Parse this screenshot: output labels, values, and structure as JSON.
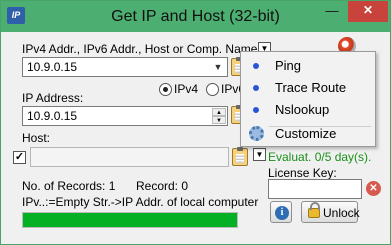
{
  "window": {
    "app_icon_text": "IP",
    "title": "Get IP and Host (32-bit)",
    "minimize_glyph": "—",
    "close_glyph": "✕"
  },
  "main": {
    "addr_label": "IPv4 Addr., IPv6 Addr., Host or Comp. Name:",
    "addr_value": "10.9.0.15",
    "ip_label": "IP Address:",
    "ip_value": "10.9.0.15",
    "ipv4_option": "IPv4",
    "ipv6_option": "IPv6",
    "ip_version_selected": "IPv4",
    "host_label": "Host:",
    "host_value": "",
    "host_checked": true,
    "records_label": "No. of Records: 1",
    "record_label": "Record: 0",
    "hint_text": "IPv..:=Empty Str.->IP Addr. of local computer",
    "progress": 1.0
  },
  "menu": {
    "items": [
      {
        "label": "Ping"
      },
      {
        "label": "Trace Route"
      },
      {
        "label": "Nslookup"
      },
      {
        "label": "Customize"
      }
    ]
  },
  "license": {
    "evaluation_text": "Evaluat. 0/5 day(s).",
    "key_label": "License Key:",
    "key_value": "",
    "unlock_label": "Unlock",
    "info_glyph": "i"
  },
  "colors": {
    "titlebar": "#4cae71",
    "close": "#c7433b",
    "progress": "#06b025",
    "evaluation_text": "#1a8f1a"
  },
  "icons": [
    "app-icon",
    "minimize-icon",
    "close-icon",
    "clipboard-icon",
    "dropdown-arrow-icon",
    "spin-up-icon",
    "spin-down-icon",
    "dot-icon",
    "gear-icon",
    "lifebuoy-icon",
    "clear-icon",
    "info-icon",
    "lock-icon"
  ]
}
